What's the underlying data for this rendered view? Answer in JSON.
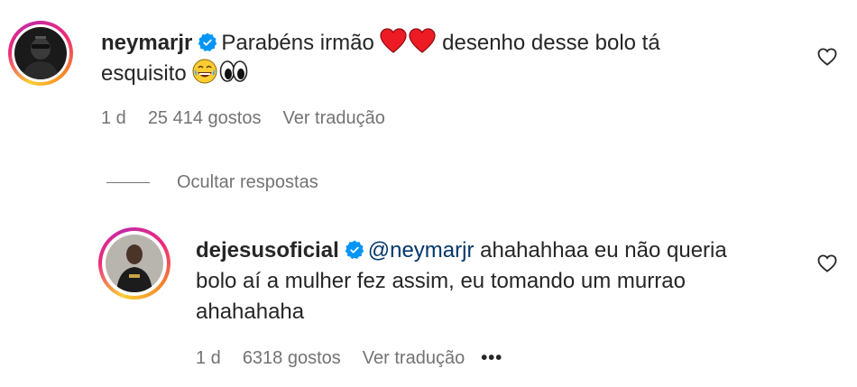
{
  "comments": [
    {
      "username": "neymarjr",
      "text": "Parabéns irmão",
      "text_after_hearts": "desenho desse bolo tá",
      "text_line2": "esquisito",
      "time": "1 d",
      "likes": "25 414 gostos",
      "translate": "Ver tradução"
    }
  ],
  "replies_toggle": "Ocultar respostas",
  "reply": {
    "username": "dejesusoficial",
    "mention": "@neymarjr",
    "text_line1": "ahahahhaa eu não queria",
    "text_line2": "bolo aí a mulher fez assim, eu tomando um murrao",
    "text_line3": "ahahahaha",
    "time": "1 d",
    "likes": "6318 gostos",
    "translate": "Ver tradução",
    "more": "•••"
  },
  "colors": {
    "verified": "#0095f6",
    "mention": "#00376b",
    "muted": "#737373",
    "heart": "#ed1c24"
  },
  "icons": [
    "verified-badge-icon",
    "red-heart-emoji",
    "laughing-emoji",
    "eyes-emoji",
    "heart-outline-icon",
    "more-dots-icon"
  ]
}
